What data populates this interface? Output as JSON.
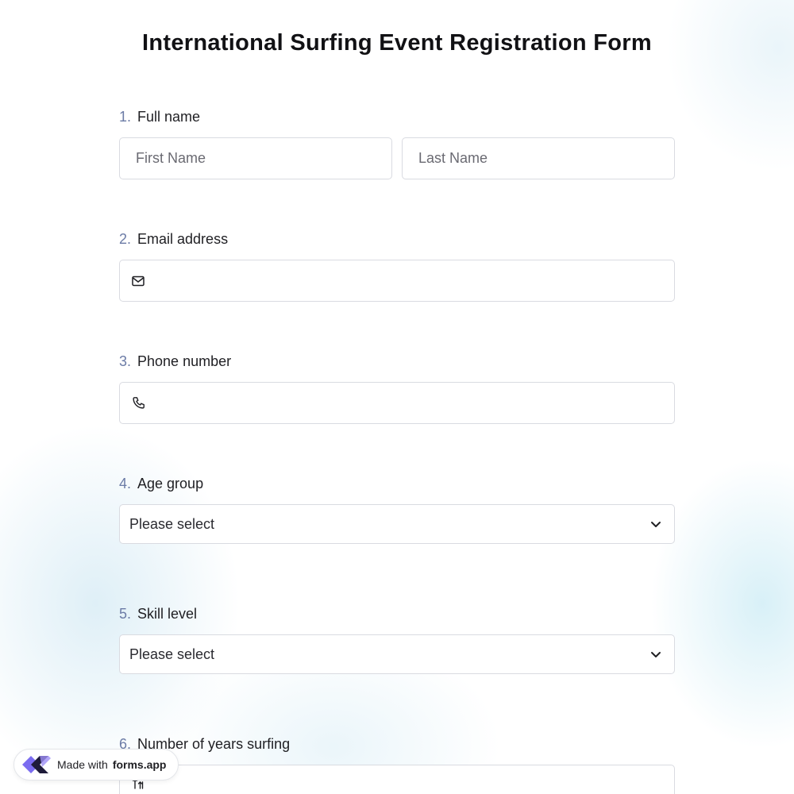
{
  "form": {
    "title": "International Surfing Event Registration Form"
  },
  "questions": [
    {
      "number": "1.",
      "label": "Full name",
      "first_placeholder": "First Name",
      "last_placeholder": "Last Name"
    },
    {
      "number": "2.",
      "label": "Email address",
      "icon": "mail-icon"
    },
    {
      "number": "3.",
      "label": "Phone number",
      "icon": "phone-icon"
    },
    {
      "number": "4.",
      "label": "Age group",
      "selected": "Please select",
      "icon": "chevron-down-icon"
    },
    {
      "number": "5.",
      "label": "Skill level",
      "selected": "Please select",
      "icon": "chevron-down-icon"
    },
    {
      "number": "6.",
      "label": "Number of years surfing",
      "icon": "number-icon"
    }
  ],
  "badge": {
    "prefix": "Made with",
    "brand": "forms.app",
    "icon": "forms-app-logo-icon"
  },
  "colors": {
    "number_accent": "#6b7ba6",
    "border": "#d9dbe1",
    "logo_primary": "#6c5ce7",
    "logo_dark": "#1e1b3a"
  }
}
